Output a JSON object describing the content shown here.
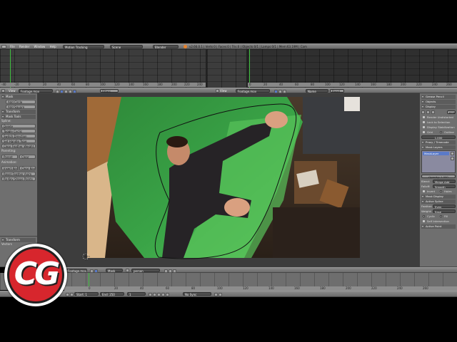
{
  "colors": {
    "accent": "#5a7ac8",
    "playhead": "#3fbf3f",
    "logo_red": "#d7262d",
    "panel": "#6f6f6f"
  },
  "top_header": {
    "menus": [
      "File",
      "Render",
      "Window",
      "Help"
    ],
    "screen_layout": "Motion Tracking",
    "scene": "Scene",
    "render_engine": "Blender Render",
    "info_text": "v2.66.0.1 | Verts:0 | Faces:0 | Tris:0 | Objects:0/1 | Lamps:0/1 | Mem:63.19M | Cam"
  },
  "dopesheet_ruler": [
    "-40",
    "-20",
    "0",
    "20",
    "40",
    "60",
    "80",
    "100",
    "120",
    "140",
    "160",
    "180",
    "200",
    "220",
    "240"
  ],
  "graph_ruler": [
    "0",
    "20",
    "40",
    "60",
    "80",
    "100",
    "120",
    "140",
    "160",
    "180",
    "200",
    "220",
    "240",
    "260"
  ],
  "clip_header_left": {
    "view_label": "View",
    "clip_name": "Footage.mov",
    "filters_label": "Filters"
  },
  "clip_header_right": {
    "view_label": "View",
    "clip_name": "Footage.mov",
    "display_mode": "Name",
    "reset_label": "Reset"
  },
  "left_panel": {
    "mask_section": "Mask",
    "add_circle": "Add Circle",
    "add_square": "Add Square",
    "transform_section": "Transform",
    "mask_tools_section": "Mask Tools",
    "spline_label": "Spline:",
    "delete": "Delete",
    "toggle_cyclic": "Toggle Cyclic",
    "switch_direction": "Switch Direction",
    "set_handle_type": "Set Handle Type",
    "clear_feather": "Clear Feather Weight",
    "parenting_label": "Parenting:",
    "parent": "Parent",
    "clear": "Clear",
    "animation_label": "Animation:",
    "insert_key": "Insert Key",
    "clear_key": "Clear Key",
    "reset_feather": "Reset Feather Anim",
    "re_key": "Re-Key Shape Points",
    "footer_title": "Transform",
    "footer_sub": "Vectors"
  },
  "right_panel": {
    "grease_pencil": "Grease Pencil",
    "objects": "Objects",
    "display": "Display",
    "display_mode": "RGB",
    "render_undistorted": "Render Undistorted",
    "lock_to_selection": "Lock to Selection",
    "display_stabilization": "Display Stabilization",
    "grid": "Grid",
    "outline": "Outline",
    "pixel_aspect": "1.000",
    "proxy_timecode": "Proxy / Timecode",
    "mask_layers": "Mask Layers",
    "layer_name": "MaskLayer",
    "opacity": "Opacity: 1.000",
    "blend_label": "Blend:",
    "blend_value": "Merge Add",
    "falloff_label": "Falloff:",
    "falloff_value": "Smooth",
    "invert": "Invert",
    "holes": "Holes",
    "mask_display": "Mask Display",
    "active_spline": "Active Spline",
    "feather_label": "Feather:",
    "feather_value": "Even",
    "weight_label": "Weight:",
    "weight_value": "Ease",
    "cyclic": "Cyclic",
    "fill": "Fill",
    "self_intersection": "Self Intersection",
    "active_point": "Active Point"
  },
  "mask_header": {
    "mask_label": "Mask",
    "mask_name": "person",
    "clip_name": "Footage.mov"
  },
  "timeline_ruler": [
    "0",
    "20",
    "40",
    "60",
    "80",
    "100",
    "120",
    "140",
    "160",
    "180",
    "200",
    "220",
    "240",
    "260"
  ],
  "timeline_bar": {
    "start": "Start: 1",
    "end": "End: 250",
    "current": "1",
    "sync": "No Sync"
  },
  "logo": {
    "text": "CG"
  }
}
